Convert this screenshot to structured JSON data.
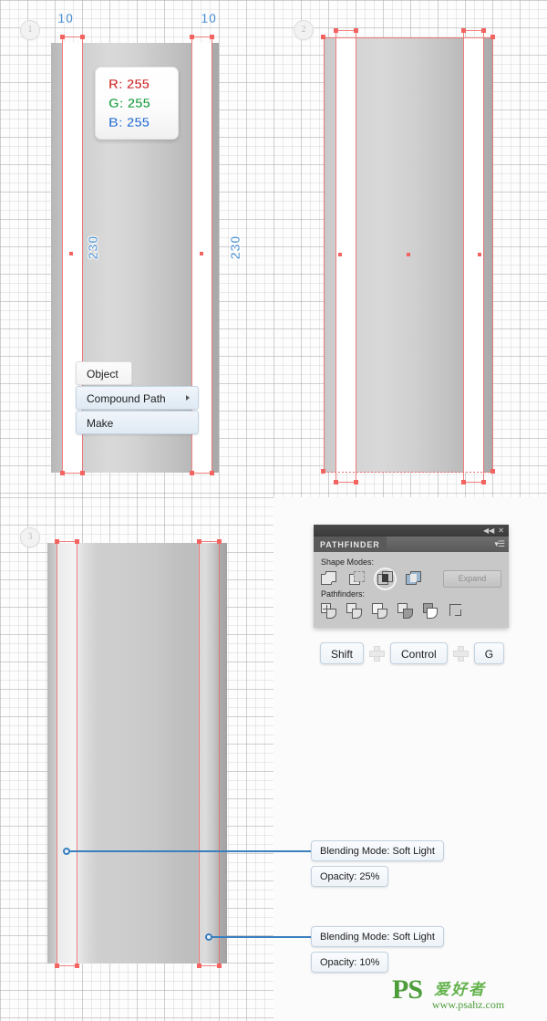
{
  "steps": [
    {
      "number": "1"
    },
    {
      "number": "2"
    },
    {
      "number": "3"
    }
  ],
  "panel1": {
    "dim_left_label": "10",
    "dim_right_label": "10",
    "height_label_left": "230",
    "height_label_right": "230",
    "rgb": {
      "r": "R: 255",
      "g": "G: 255",
      "b": "B: 255"
    },
    "menu": {
      "object": "Object",
      "compound_path": "Compound Path",
      "make": "Make"
    }
  },
  "panel3": {
    "callouts": [
      {
        "blend": "Blending Mode: Soft Light",
        "opacity": "Opacity: 25%"
      },
      {
        "blend": "Blending Mode: Soft Light",
        "opacity": "Opacity: 10%"
      }
    ]
  },
  "pathfinder": {
    "title": "PATHFINDER",
    "collapse_icon": "◀◀",
    "close_icon": "✕",
    "menu_icon": "▾☰",
    "shape_modes_label": "Shape Modes:",
    "pathfinders_label": "Pathfinders:",
    "expand_label": "Expand",
    "shape_modes": [
      {
        "name": "unite-icon",
        "selected": false
      },
      {
        "name": "minus-front-icon",
        "selected": false
      },
      {
        "name": "intersect-icon",
        "selected": true
      },
      {
        "name": "exclude-icon",
        "selected": false
      }
    ],
    "pathfinders": [
      {
        "name": "divide-icon"
      },
      {
        "name": "trim-icon"
      },
      {
        "name": "merge-icon"
      },
      {
        "name": "crop-icon"
      },
      {
        "name": "outline-icon"
      },
      {
        "name": "minus-back-icon"
      }
    ]
  },
  "shortcut": {
    "key1": "Shift",
    "key2": "Control",
    "key3": "G",
    "separator": "plus-icon"
  },
  "watermark": {
    "logo": "PS",
    "chinese": "爱好者",
    "url": "www.psahz.com"
  },
  "colors": {
    "guide_red": "#f06a6a",
    "dimension_blue": "#4c8fd0",
    "leader_blue": "#3a7fbe",
    "watermark_green": "#4c9c3a",
    "rgb_r": "#d02a2a",
    "rgb_g": "#199d3e",
    "rgb_b": "#2b6fd0"
  }
}
